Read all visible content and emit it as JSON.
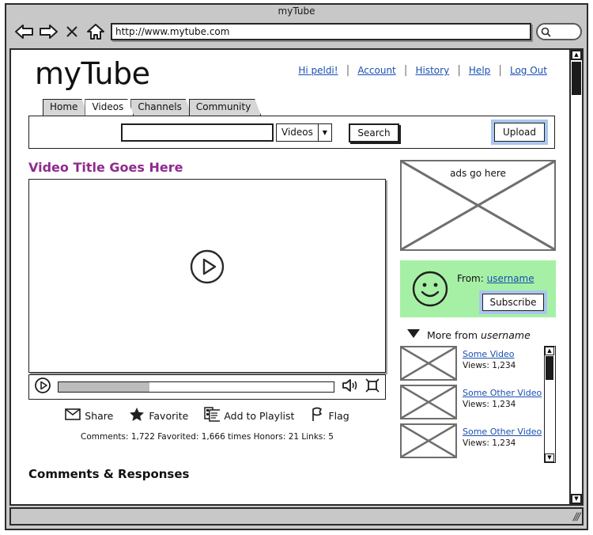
{
  "window": {
    "title": "myTube",
    "url": "http://www.mytube.com",
    "back_icon": "back-arrow-icon",
    "forward_icon": "forward-arrow-icon",
    "stop_icon": "stop-x-icon",
    "home_icon": "home-icon",
    "chrome_search_icon": "magnifier-icon",
    "chrome_search_value": ""
  },
  "header": {
    "logo": "myTube",
    "links": [
      {
        "label": "Hi peldi!"
      },
      {
        "label": "Account"
      },
      {
        "label": "History"
      },
      {
        "label": "Help"
      },
      {
        "label": "Log Out"
      }
    ]
  },
  "tabs": [
    {
      "label": "Home",
      "active": false
    },
    {
      "label": "Videos",
      "active": true
    },
    {
      "label": "Channels",
      "active": false
    },
    {
      "label": "Community",
      "active": false
    }
  ],
  "search": {
    "query": "",
    "placeholder": "",
    "scope_selected": "Videos",
    "scope_arrow": "▼",
    "search_label": "Search",
    "upload_label": "Upload"
  },
  "video": {
    "title": "Video Title Goes Here",
    "play_icon": "play-circle-icon",
    "controls": {
      "play_icon": "play-circle-icon",
      "progress_percent": 33,
      "volume_icon": "volume-icon",
      "fullscreen_icon": "fullscreen-icon"
    },
    "actions": [
      {
        "label": "Share",
        "icon": "envelope-icon"
      },
      {
        "label": "Favorite",
        "icon": "star-icon"
      },
      {
        "label": "Add to Playlist",
        "icon": "documents-icon"
      },
      {
        "label": "Flag",
        "icon": "flag-icon"
      }
    ],
    "stats": "Comments: 1,722  Favorited: 1,666 times  Honors: 21  Links: 5",
    "comments_heading": "Comments & Responses"
  },
  "sidebar": {
    "ad_label": "ads go here",
    "from_prefix": "From:",
    "from_username": "username",
    "subscribe_label": "Subscribe",
    "more_from_prefix": "More from",
    "more_from_username": "username",
    "more_from_arrow": "▼",
    "videos": [
      {
        "title": "Some Video",
        "views": "Views: 1,234"
      },
      {
        "title": "Some Other Video",
        "views": "Views: 1,234"
      },
      {
        "title": "Some Other Video",
        "views": "Views: 1,234"
      }
    ]
  },
  "scrollbars": {
    "up_arrow": "▲",
    "down_arrow": "▼"
  },
  "statusbar": {
    "text": ""
  },
  "colors": {
    "title_purple": "#8e2a8e",
    "link_blue": "#1a4fb4",
    "panel_green": "#a6f0a6",
    "highlight_blue": "#a9c6ef",
    "chrome_gray": "#c8c8c8"
  }
}
